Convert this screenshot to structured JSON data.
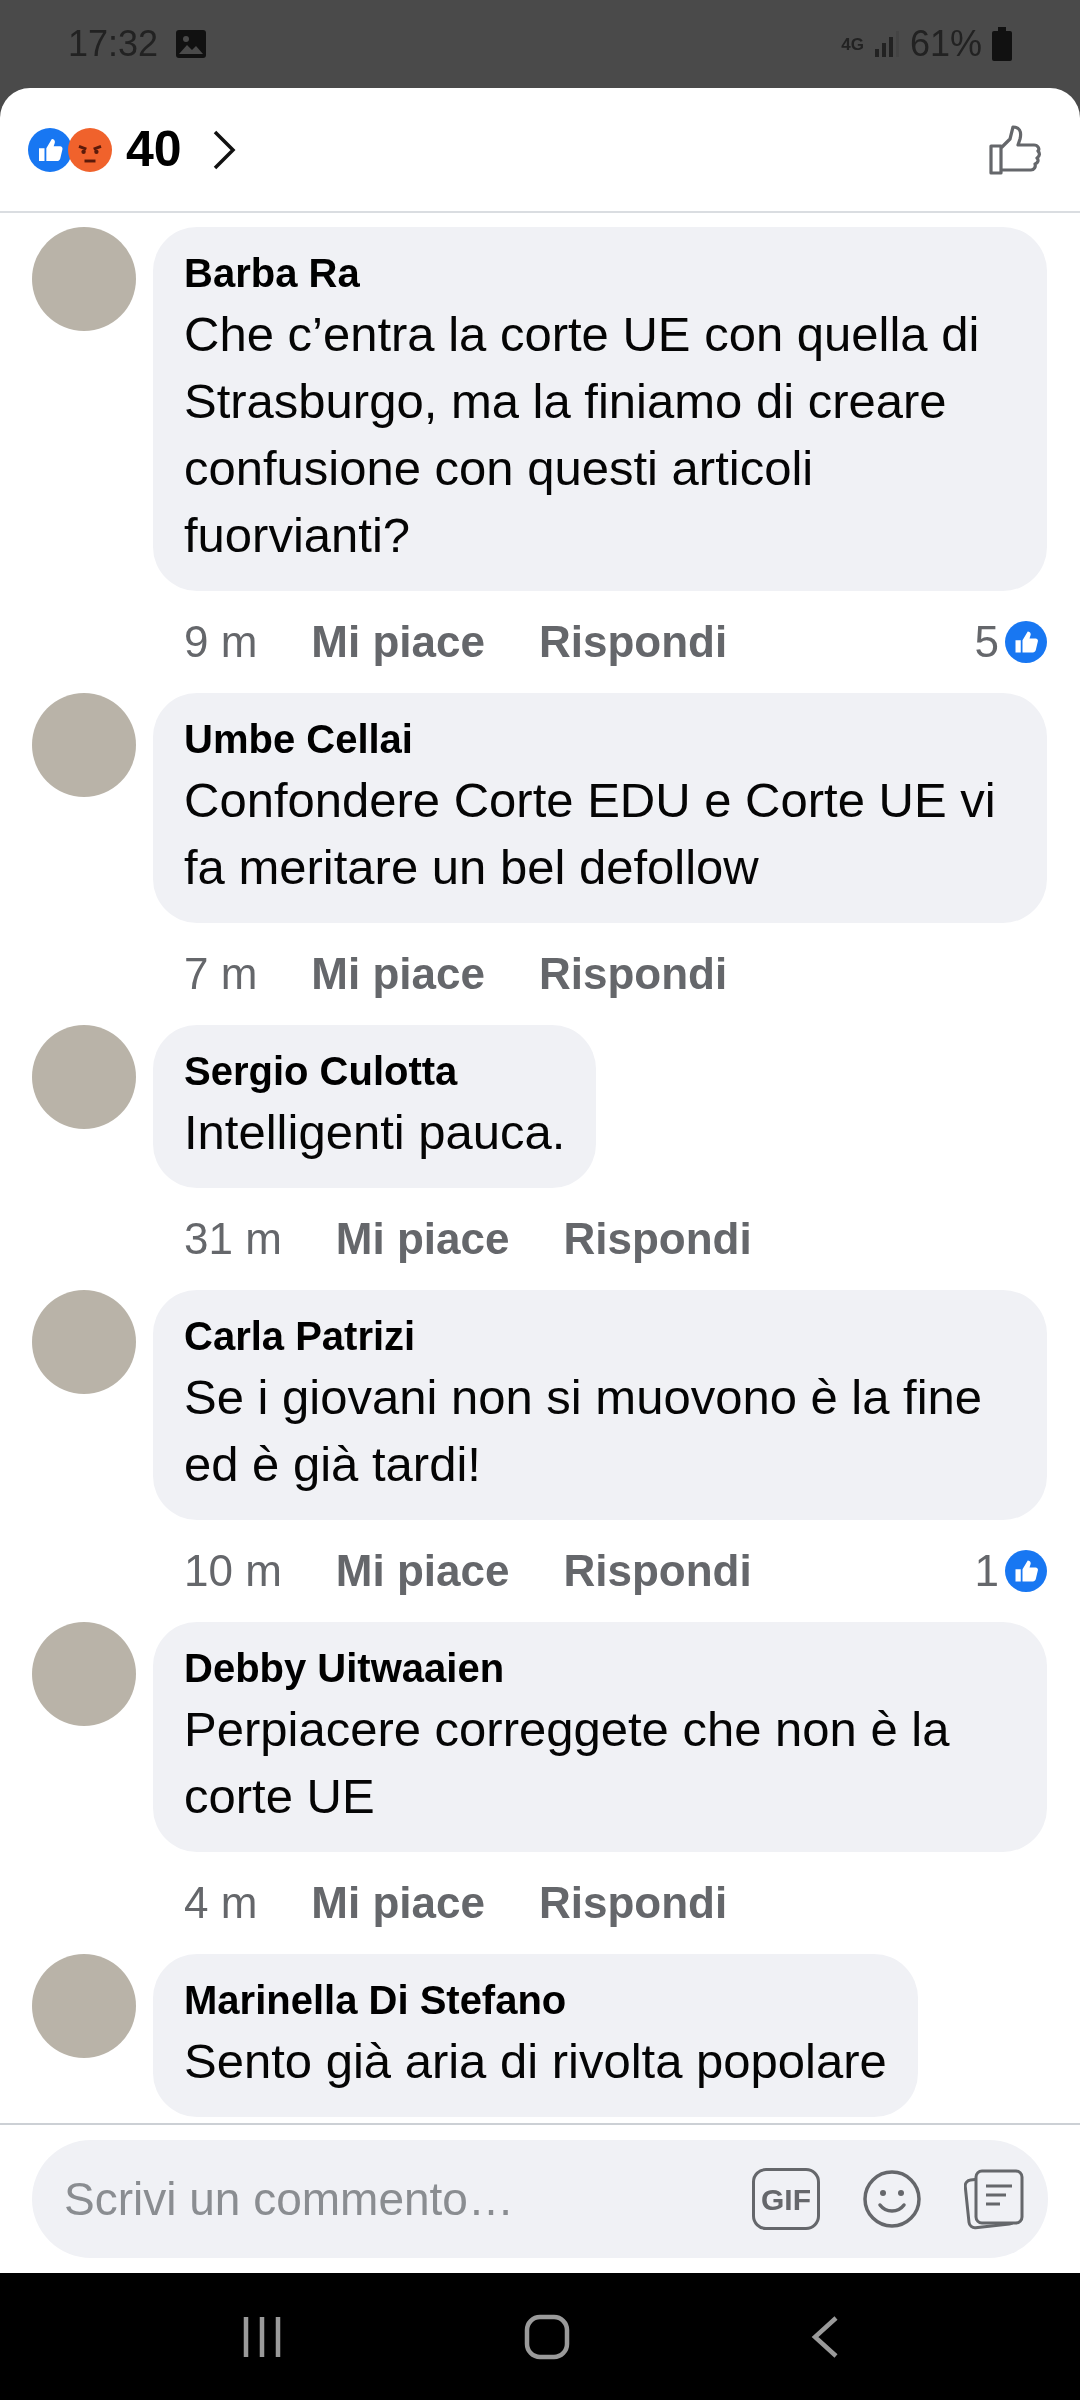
{
  "status_bar": {
    "time": "17:32",
    "network": "4G",
    "battery": "61%"
  },
  "header": {
    "reaction_count": "40"
  },
  "comments": [
    {
      "author": "Barba Ra",
      "text": "Che c’entra la corte UE con quella di Strasburgo, ma la finiamo di creare confusione con questi articoli fuorvianti?",
      "time": "9 m",
      "like": "Mi piace",
      "reply": "Rispondi",
      "likes": "5"
    },
    {
      "author": "Umbe Cellai",
      "text": "Confondere Corte EDU e Corte UE vi fa meritare un bel defollow",
      "time": "7 m",
      "like": "Mi piace",
      "reply": "Rispondi"
    },
    {
      "author": "Sergio Culotta",
      "text": "Intelligenti pauca.",
      "time": "31 m",
      "like": "Mi piace",
      "reply": "Rispondi"
    },
    {
      "author": "Carla Patrizi",
      "text": "Se i giovani non si muovono è la fine ed è già tardi!",
      "time": "10 m",
      "like": "Mi piace",
      "reply": "Rispondi",
      "likes": "1"
    },
    {
      "author": "Debby Uitwaaien",
      "text": "Perpiacere correggete che non è la corte UE",
      "time": "4 m",
      "like": "Mi piace",
      "reply": "Rispondi"
    },
    {
      "author": "Marinella Di Stefano",
      "text": "Sento già aria di rivolta popolare"
    }
  ],
  "composer": {
    "placeholder": "Scrivi un commento…",
    "gif": "GIF"
  }
}
